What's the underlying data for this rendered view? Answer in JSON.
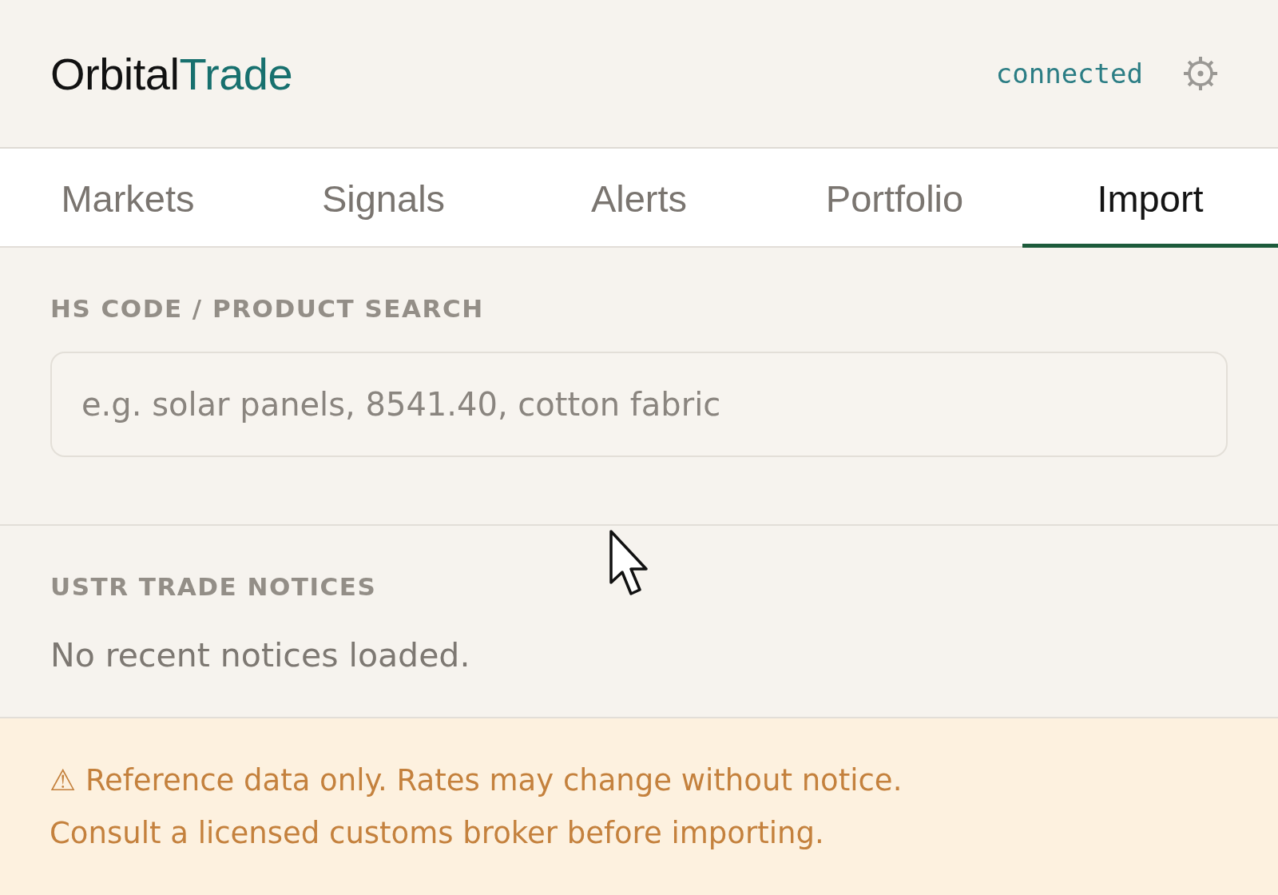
{
  "header": {
    "logo": {
      "text_1": "Orbital",
      "text_2": "Trade"
    },
    "status": "connected"
  },
  "tabs": [
    {
      "label": "Markets",
      "selected": false
    },
    {
      "label": "Signals",
      "selected": false
    },
    {
      "label": "Alerts",
      "selected": false
    },
    {
      "label": "Portfolio",
      "selected": false
    },
    {
      "label": "Import",
      "selected": true
    }
  ],
  "search_section": {
    "label": "HS CODE / PRODUCT SEARCH",
    "search": {
      "placeholder": "e.g. solar panels, 8541.40, cotton fabric"
    }
  },
  "notices_section": {
    "label": "USTR TRADE NOTICES",
    "empty_text": "No recent notices loaded."
  },
  "disclaimer": {
    "lines": [
      "⚠ Reference data only. Rates may change without notice.",
      "Consult a licensed customs broker before importing."
    ]
  }
}
